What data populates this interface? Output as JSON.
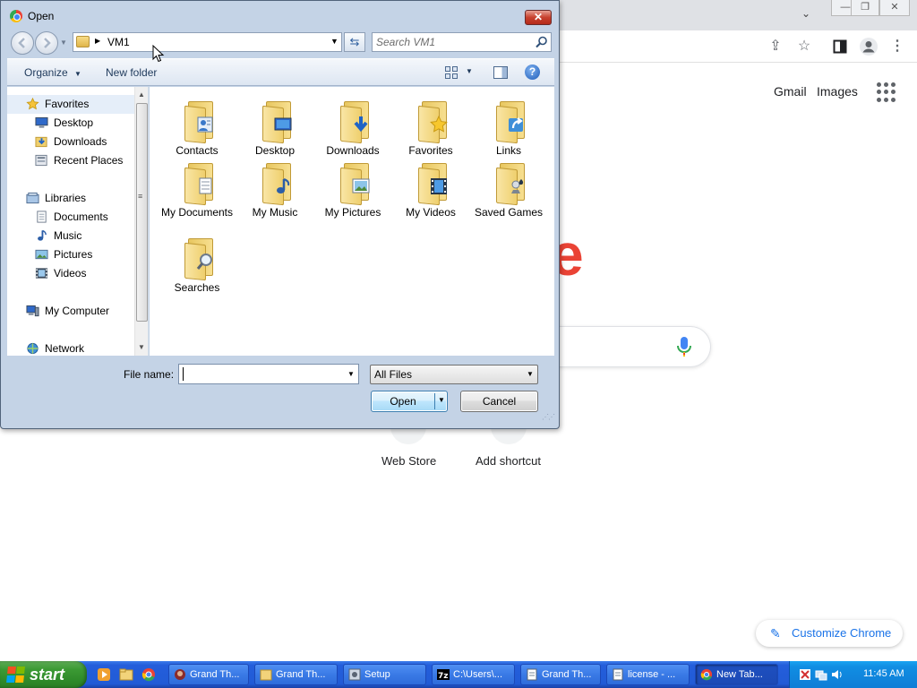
{
  "browser": {
    "links": {
      "gmail": "Gmail",
      "images": "Images"
    },
    "logo_fragment": "e",
    "shortcuts": [
      "Web Store",
      "Add shortcut"
    ],
    "customize_label": "Customize Chrome"
  },
  "dialog": {
    "title": "Open",
    "close_glyph": "✕",
    "address": {
      "path": "VM1"
    },
    "search": {
      "placeholder": "Search VM1"
    },
    "command_bar": {
      "organize": "Organize",
      "new_folder": "New folder",
      "help_glyph": "?"
    },
    "nav": {
      "items": [
        {
          "label": "Favorites",
          "icon": "star-icon"
        },
        {
          "label": "Desktop",
          "icon": "desktop-icon"
        },
        {
          "label": "Downloads",
          "icon": "downloads-icon"
        },
        {
          "label": "Recent Places",
          "icon": "recent-places-icon"
        },
        {
          "label": "Libraries",
          "icon": "libraries-icon"
        },
        {
          "label": "Documents",
          "icon": "documents-icon"
        },
        {
          "label": "Music",
          "icon": "music-icon"
        },
        {
          "label": "Pictures",
          "icon": "pictures-icon"
        },
        {
          "label": "Videos",
          "icon": "videos-icon"
        },
        {
          "label": "My Computer",
          "icon": "computer-icon"
        },
        {
          "label": "Network",
          "icon": "network-icon"
        }
      ]
    },
    "folders": [
      {
        "label": "Contacts",
        "icon": "contacts-icon"
      },
      {
        "label": "Desktop",
        "icon": "desktop-icon"
      },
      {
        "label": "Downloads",
        "icon": "downloads-icon"
      },
      {
        "label": "Favorites",
        "icon": "favorites-icon"
      },
      {
        "label": "Links",
        "icon": "links-icon"
      },
      {
        "label": "My Documents",
        "icon": "documents-icon"
      },
      {
        "label": "My Music",
        "icon": "music-icon"
      },
      {
        "label": "My Pictures",
        "icon": "pictures-icon"
      },
      {
        "label": "My Videos",
        "icon": "videos-icon"
      },
      {
        "label": "Saved Games",
        "icon": "games-icon"
      },
      {
        "label": "Searches",
        "icon": "magnifier-icon"
      }
    ],
    "filename": {
      "label": "File name:",
      "value": ""
    },
    "filter": {
      "selected": "All Files"
    },
    "buttons": {
      "open": "Open",
      "cancel": "Cancel"
    }
  },
  "taskbar": {
    "start_label": "start",
    "tasks": [
      {
        "label": "Grand Th..."
      },
      {
        "label": "Grand Th..."
      },
      {
        "label": "Setup"
      },
      {
        "label": "C:\\Users\\..."
      },
      {
        "label": "Grand Th..."
      },
      {
        "label": "license - ..."
      },
      {
        "label": "New Tab..."
      }
    ],
    "clock": "11:45 AM"
  },
  "colors": {
    "taskbar": "#245edb",
    "start": "#3c9a34",
    "dialog_frame": "#c4d3e6",
    "logo_red": "#ea4335",
    "accent_blue": "#1a73e8"
  }
}
